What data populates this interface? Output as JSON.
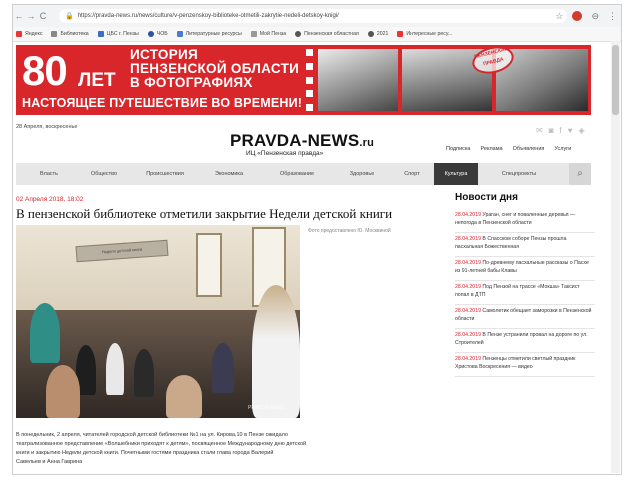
{
  "browser": {
    "url": "https://pravda-news.ru/news/culture/v-penzenskoy-biblioteke-otmetili-zakrytie-nedeli-detskoy-knigi/",
    "bookmarks": [
      "Яндекс",
      "Библиотека",
      "ЦБС г. Пензы",
      "ЧОБ",
      "Литературные ресурсы",
      "Мой Пенза",
      "Пензенская областная",
      "2021",
      "Интересные ресу..."
    ]
  },
  "banner": {
    "number": "80",
    "years": "ЛЕТ",
    "title_lines": [
      "ИСТОРИЯ",
      "ПЕНЗЕНСКОЙ ОБЛАСТИ",
      "В ФОТОГРАФИЯХ"
    ],
    "subtitle": "НАСТОЯЩЕЕ ПУТЕШЕСТВИЕ ВО ВРЕМЕНИ!",
    "stamp": "ПЕНЗЕНСКАЯ ПРАВДА",
    "colors": {
      "brand_red": "#d8262b"
    }
  },
  "header": {
    "date": "28 Апреля, воскресенье",
    "logo_main": "PRAVDA-NEWS",
    "logo_tld": ".ru",
    "logo_sub": "ИЦ «Пензенская правда»",
    "links": [
      "Подписка",
      "Реклама",
      "Объявления",
      "Услуги"
    ],
    "social_icons": [
      "mail-icon",
      "ok-icon",
      "facebook-icon",
      "vk-icon",
      "rss-icon"
    ]
  },
  "nav": {
    "items": [
      "Власть",
      "Общество",
      "Происшествия",
      "Экономика",
      "Образование",
      "Здоровье",
      "Спорт",
      "Культура",
      "Спецпроекты"
    ],
    "active": "Культура"
  },
  "article": {
    "date": "02 Апреля 2018, 18:02",
    "title": "В пензенской библиотеке отметили закрытие Недели детской книги",
    "photo_caption": "Фото предоставлено Ю. Москвиной",
    "photo_watermark": "PRAVDA-NEWS",
    "photo_banner": "Неделя детской книги",
    "body": [
      "В понедельник, 2 апреля, читателей городской детской библиотеки №1 на ул. Кирова,10 в Пензе ожидало",
      "театрализованное представление «Волшебники приходят к детям», посвященное Международному дню детской",
      "книги и закрытию Недели детской книги. Почетными гостями праздника стали глава города Валерий",
      "Савельев и  Анна Гаврина"
    ]
  },
  "sidebar": {
    "title": "Новости дня",
    "items": [
      {
        "date": "28.04.2019",
        "text": "Ураган, снег и поваленные деревья — непогода в Пензенской области"
      },
      {
        "date": "28.04.2019",
        "text": "В Спасском соборе Пензы прошла пасхальная Божественная"
      },
      {
        "date": "28.04.2019",
        "text": "По-древнему пасхальные рассказы о Пасхе из 91-летней бабы Клавы"
      },
      {
        "date": "28.04.2019",
        "text": "Под Пензой на трассе «Мокша» Таксист попал в ДТП"
      },
      {
        "date": "28.04.2019",
        "text": "Самолетик обещает заморозки в Пензенской области"
      },
      {
        "date": "28.04.2019",
        "text": "В Пензе устранили провал на дороге по ул. Строителей"
      },
      {
        "date": "28.04.2019",
        "text": "Пензенцы отметили светлый праздник Христова Воскресения — видео"
      }
    ]
  }
}
